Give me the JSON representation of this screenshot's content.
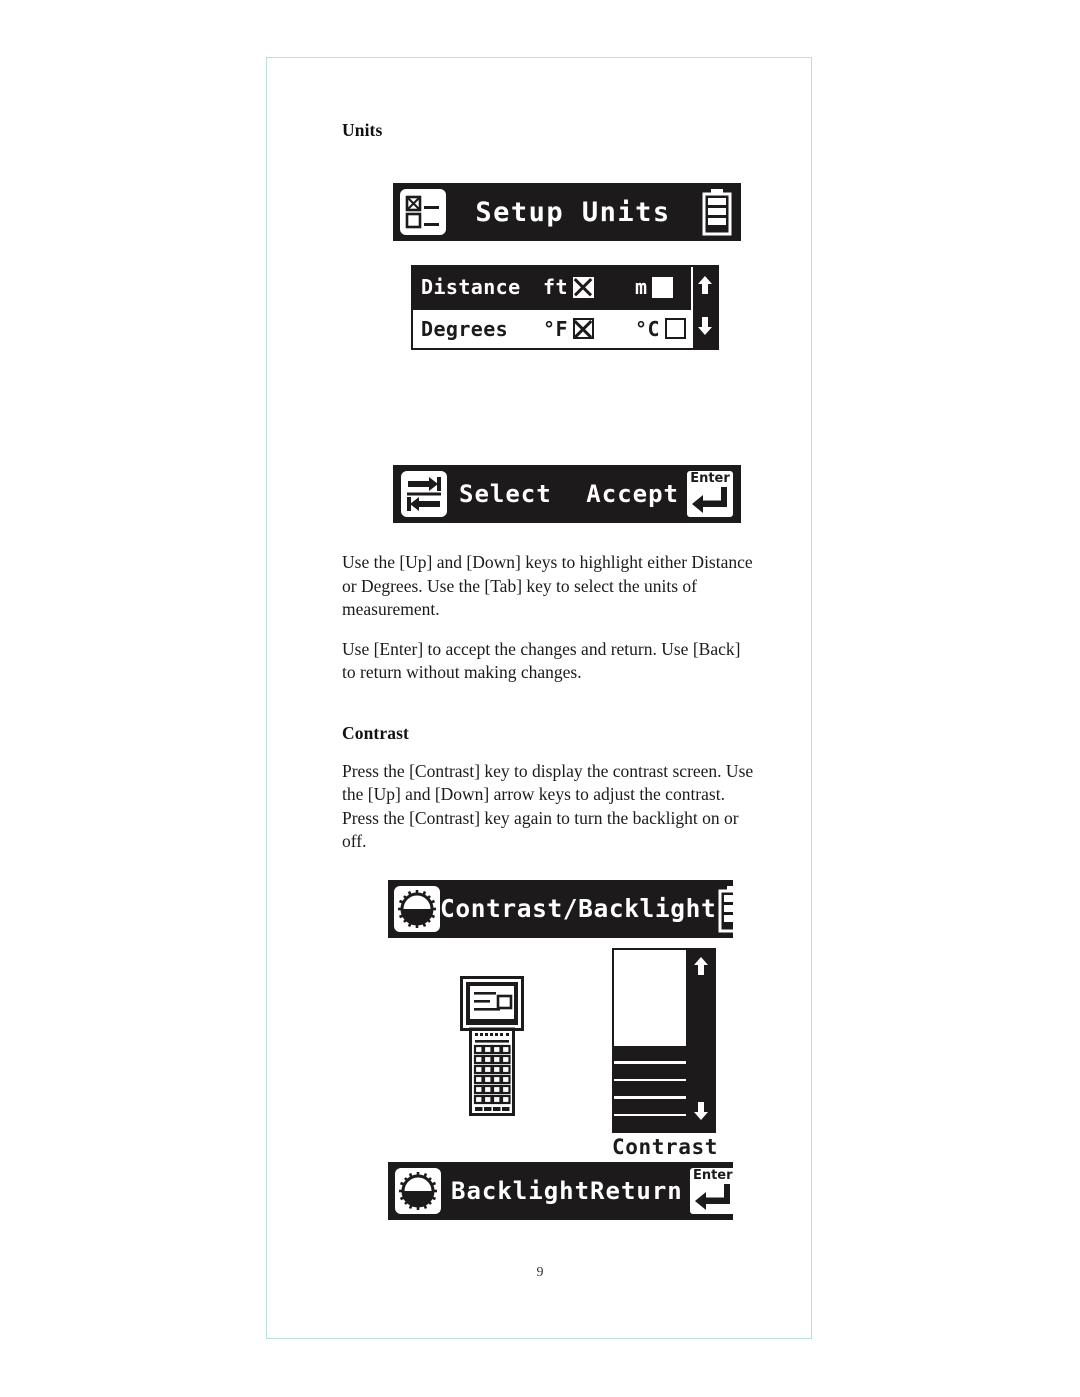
{
  "page": {
    "number": "9",
    "border_color": "#b9e3d0"
  },
  "sections": [
    {
      "heading": "Units",
      "paragraphs": [
        "Use the [Up] and [Down] keys to highlight either Distance or Degrees. Use the [Tab] key to select the units of measurement.",
        "Use [Enter] to accept the changes and return. Use [Back] to return without making changes."
      ]
    },
    {
      "heading": "Contrast",
      "paragraphs": [
        "Press the [Contrast] key to display the contrast screen. Use the [Up] and [Down] arrow keys to adjust the contrast. Press the [Contrast] key again to turn the backlight on or off."
      ]
    }
  ],
  "units_screen": {
    "icon": "checkbox-list-icon",
    "title": "Setup Units",
    "battery_icon": "battery-icon",
    "scroll_up_icon": "arrow-up-icon",
    "scroll_down_icon": "arrow-down-icon",
    "rows": [
      {
        "label": "Distance",
        "selected": true,
        "options": [
          {
            "label": "ft",
            "checked": true
          },
          {
            "label": "m",
            "checked": false
          }
        ]
      },
      {
        "label": "Degrees",
        "selected": false,
        "options": [
          {
            "label": "°F",
            "checked": true
          },
          {
            "label": "°C",
            "checked": false
          }
        ]
      }
    ],
    "softkeys": {
      "left_icon": "tab-key-icon",
      "left_label": "Select",
      "right_label": "Accept",
      "right_icon": "enter-key-icon",
      "right_icon_text": "Enter"
    }
  },
  "contrast_screen": {
    "icon": "brightness-sun-icon",
    "title": "Contrast/Backlight",
    "battery_icon": "battery-icon",
    "device_icon": "handheld-device-icon",
    "gauge": {
      "caption": "Contrast",
      "fill_percent": 48,
      "segments": 5,
      "up_icon": "arrow-up-icon",
      "down_icon": "arrow-down-icon"
    },
    "softkeys": {
      "left_icon": "brightness-sun-icon",
      "left_label": "Backlight",
      "right_label": "Return",
      "right_icon": "enter-key-icon",
      "right_icon_text": "Enter"
    }
  }
}
